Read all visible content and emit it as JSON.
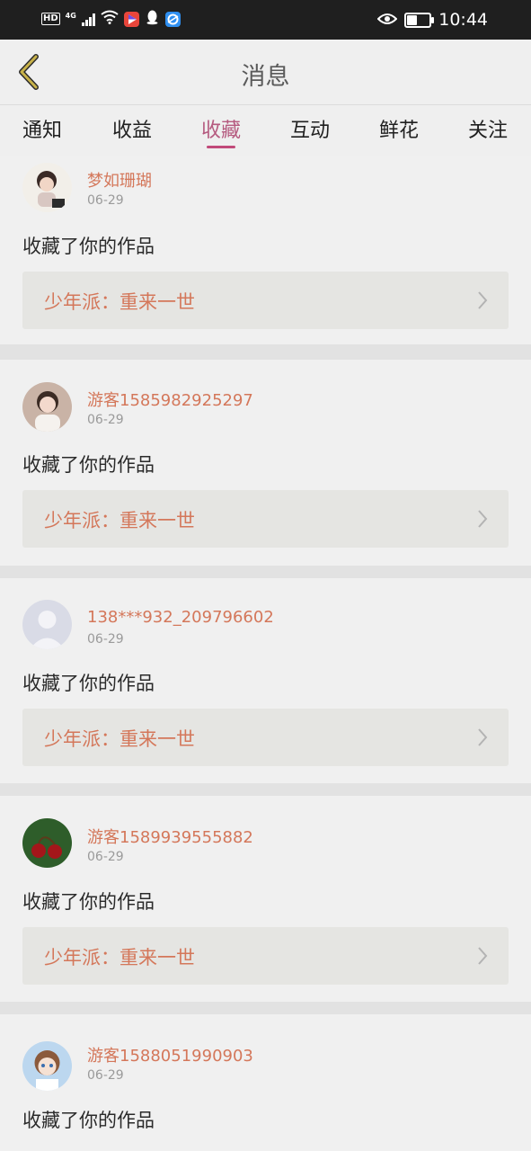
{
  "status_bar": {
    "hd": "HD",
    "network": "4G",
    "time": "10:44",
    "icons": [
      "signal-icon",
      "wifi-icon",
      "video-app-icon",
      "qq-icon",
      "browser-icon",
      "eye-icon",
      "battery-icon"
    ]
  },
  "nav": {
    "title": "消息",
    "back_icon": "chevron-left-icon"
  },
  "tabs": [
    {
      "label": "通知",
      "active": false
    },
    {
      "label": "收益",
      "active": false
    },
    {
      "label": "收藏",
      "active": true
    },
    {
      "label": "互动",
      "active": false
    },
    {
      "label": "鲜花",
      "active": false
    },
    {
      "label": "关注",
      "active": false
    }
  ],
  "colors": {
    "accent": "#c14a7a",
    "username": "#d4775a",
    "work_bg": "#e5e5e2",
    "statusbar": "#1f1f1f"
  },
  "messages": [
    {
      "username": "梦如珊瑚",
      "date": "06-29",
      "action": "收藏了你的作品",
      "work": "少年派：重来一世"
    },
    {
      "username": "游客1585982925297",
      "date": "06-29",
      "action": "收藏了你的作品",
      "work": "少年派：重来一世"
    },
    {
      "username": "138***932_209796602",
      "date": "06-29",
      "action": "收藏了你的作品",
      "work": "少年派：重来一世"
    },
    {
      "username": "游客1589939555882",
      "date": "06-29",
      "action": "收藏了你的作品",
      "work": "少年派：重来一世"
    },
    {
      "username": "游客1588051990903",
      "date": "06-29",
      "action": "收藏了你的作品",
      "work": ""
    }
  ]
}
